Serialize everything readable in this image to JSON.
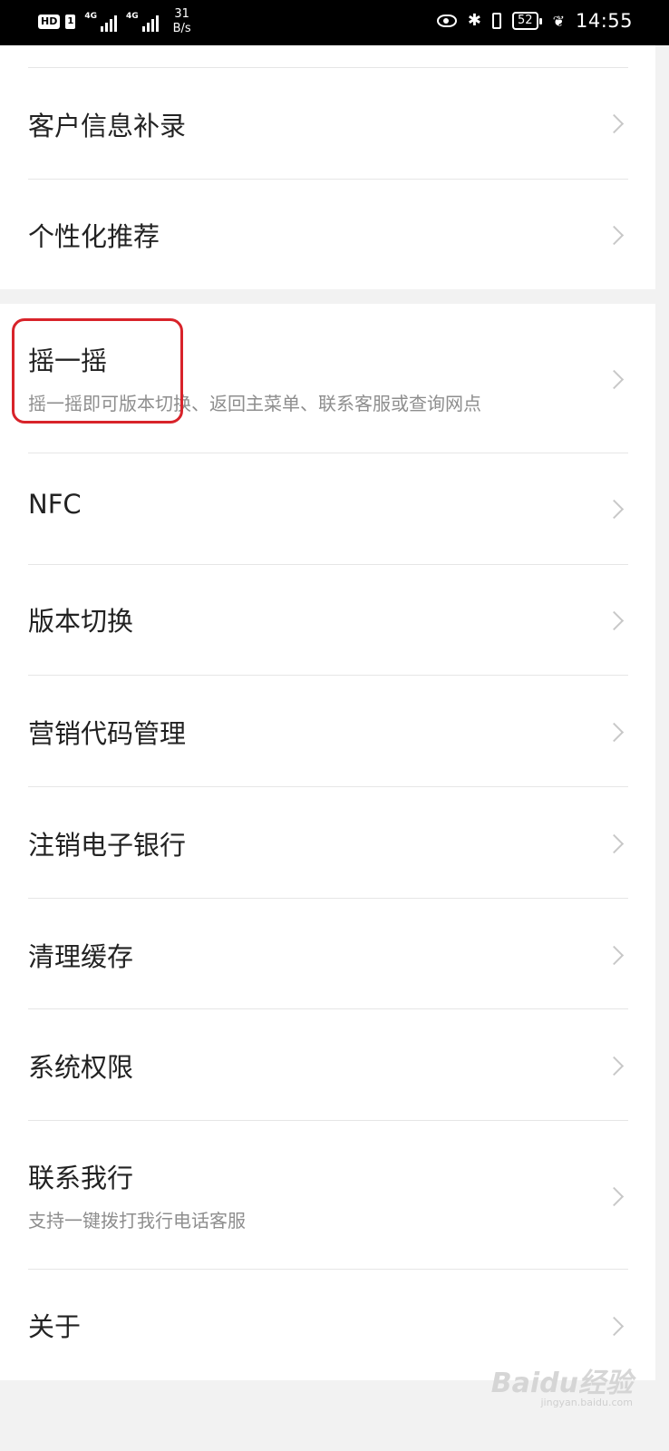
{
  "status_bar": {
    "hd": "HD",
    "sim": "1",
    "network1": "4G",
    "network2": "4G",
    "speed_value": "31",
    "speed_unit": "B/s",
    "battery": "52",
    "time": "14:55",
    "icons": [
      "eye-comfort-icon",
      "bluetooth-icon",
      "vibrate-icon",
      "battery-icon",
      "power-saving-leaf-icon"
    ]
  },
  "settings": {
    "group1": [
      {
        "title": "客户信息补录"
      },
      {
        "title": "个性化推荐"
      }
    ],
    "group2": [
      {
        "title": "摇一摇",
        "subtitle": "摇一摇即可版本切换、返回主菜单、联系客服或查询网点"
      },
      {
        "title": "NFC"
      },
      {
        "title": "版本切换"
      },
      {
        "title": "营销代码管理"
      },
      {
        "title": "注销电子银行"
      },
      {
        "title": "清理缓存"
      },
      {
        "title": "系统权限"
      },
      {
        "title": "联系我行",
        "subtitle": "支持一键拨打我行电话客服"
      },
      {
        "title": "关于"
      }
    ]
  },
  "annotation": {
    "color": "#d8232a"
  },
  "watermark": {
    "text": "Baidu经验",
    "sub": "jingyan.baidu.com"
  }
}
